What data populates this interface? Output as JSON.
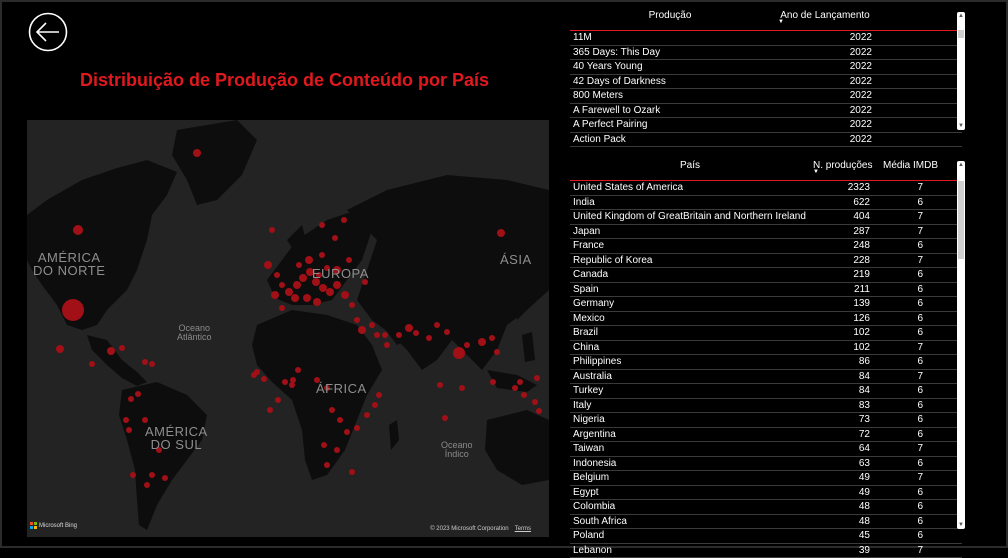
{
  "page": {
    "title": "Distribuição de Produção de Conteúdo por País",
    "back_icon": "back-arrow-icon",
    "accent_color": "#e0191f",
    "background": "#000000"
  },
  "map": {
    "labels": {
      "north_america": "AMÉRICA\nDO NORTE",
      "europe": "EUROPA",
      "asia": "ÁSIA",
      "africa": "ÁFRICA",
      "south_america": "AMÉRICA\nDO SUL",
      "atlantic": "Oceano\nAtlântico",
      "indian": "Oceano\nÍndico"
    },
    "attribution": "Microsoft Bing",
    "copyright": "© 2023 Microsoft Corporation",
    "terms": "Terms",
    "marker_color": "#a11016"
  },
  "productions": {
    "columns": [
      "Produção",
      "Ano de Lançamento"
    ],
    "rows": [
      [
        "11M",
        "2022"
      ],
      [
        "365 Days: This Day",
        "2022"
      ],
      [
        "40 Years Young",
        "2022"
      ],
      [
        "42 Days of Darkness",
        "2022"
      ],
      [
        "800 Meters",
        "2022"
      ],
      [
        "A Farewell to Ozark",
        "2022"
      ],
      [
        "A Perfect Pairing",
        "2022"
      ],
      [
        "Action Pack",
        "2022"
      ]
    ]
  },
  "countries": {
    "columns": [
      "País",
      "N. produções",
      "Média IMDB"
    ],
    "rows": [
      [
        "United States of America",
        "2323",
        "7"
      ],
      [
        "India",
        "622",
        "6"
      ],
      [
        "United Kingdom of GreatBritain and Northern Ireland",
        "404",
        "7"
      ],
      [
        "Japan",
        "287",
        "7"
      ],
      [
        "France",
        "248",
        "6"
      ],
      [
        "Republic of Korea",
        "228",
        "7"
      ],
      [
        "Canada",
        "219",
        "6"
      ],
      [
        "Spain",
        "211",
        "6"
      ],
      [
        "Germany",
        "139",
        "6"
      ],
      [
        "Mexico",
        "126",
        "6"
      ],
      [
        "Brazil",
        "102",
        "6"
      ],
      [
        "China",
        "102",
        "7"
      ],
      [
        "Philippines",
        "86",
        "6"
      ],
      [
        "Australia",
        "84",
        "7"
      ],
      [
        "Turkey",
        "84",
        "6"
      ],
      [
        "Italy",
        "83",
        "6"
      ],
      [
        "Nigeria",
        "73",
        "6"
      ],
      [
        "Argentina",
        "72",
        "6"
      ],
      [
        "Taiwan",
        "64",
        "7"
      ],
      [
        "Indonesia",
        "63",
        "6"
      ],
      [
        "Belgium",
        "49",
        "7"
      ],
      [
        "Egypt",
        "49",
        "6"
      ],
      [
        "Colombia",
        "48",
        "6"
      ],
      [
        "South Africa",
        "48",
        "6"
      ],
      [
        "Poland",
        "45",
        "6"
      ],
      [
        "Lebanon",
        "39",
        "7"
      ]
    ]
  }
}
